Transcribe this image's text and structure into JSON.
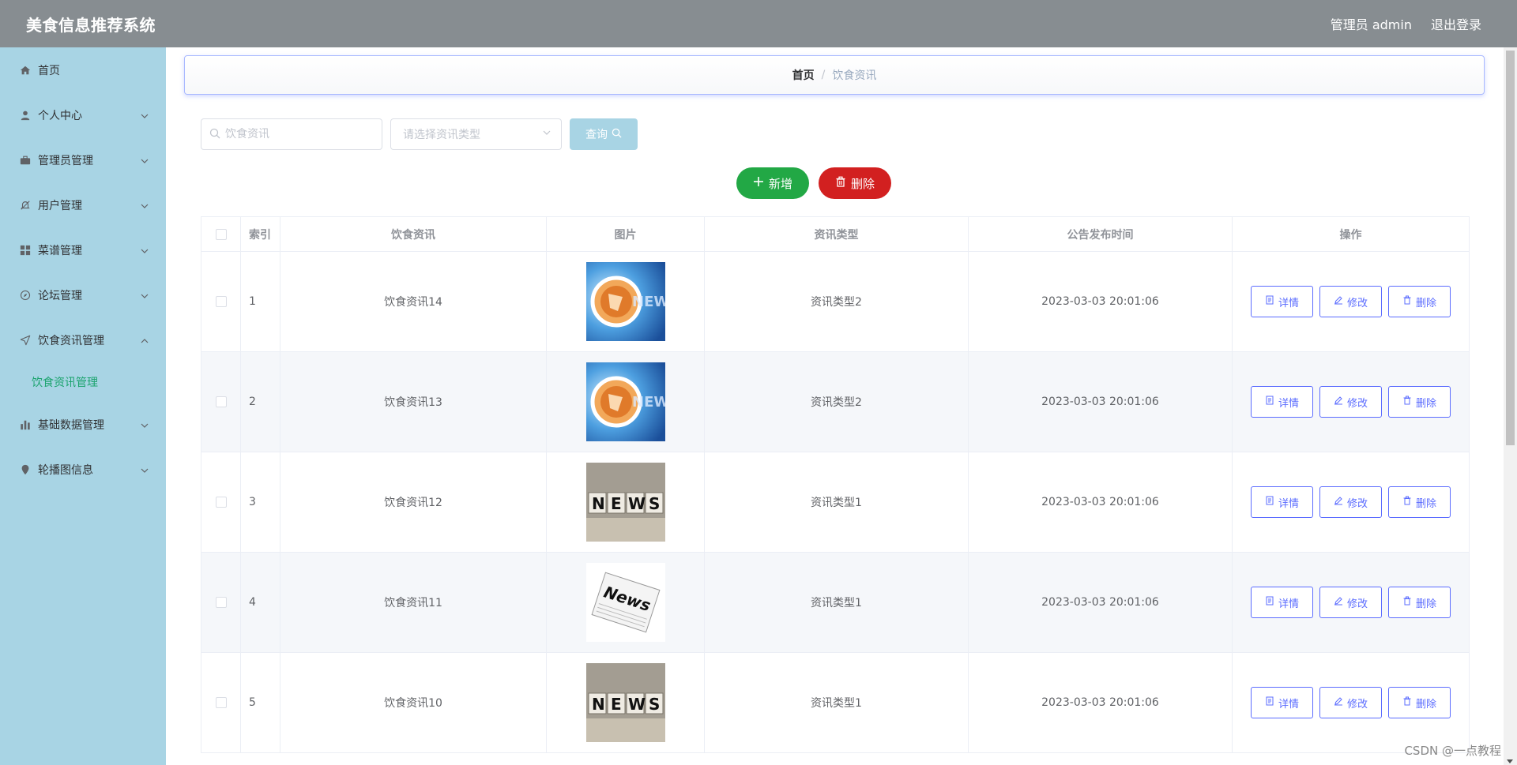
{
  "app": {
    "title": "美食信息推荐系统"
  },
  "header": {
    "user_label": "管理员 admin",
    "logout_label": "退出登录"
  },
  "sidebar": {
    "items": [
      {
        "label": "首页",
        "icon": "home-icon",
        "expandable": false
      },
      {
        "label": "个人中心",
        "icon": "user-icon",
        "expandable": true
      },
      {
        "label": "管理员管理",
        "icon": "briefcase-icon",
        "expandable": true
      },
      {
        "label": "用户管理",
        "icon": "bell-off-icon",
        "expandable": true
      },
      {
        "label": "菜谱管理",
        "icon": "grid-icon",
        "expandable": true
      },
      {
        "label": "论坛管理",
        "icon": "compass-icon",
        "expandable": true
      },
      {
        "label": "饮食资讯管理",
        "icon": "send-icon",
        "expandable": true,
        "expanded": true,
        "children": [
          "饮食资讯管理"
        ]
      },
      {
        "label": "基础数据管理",
        "icon": "bar-chart-icon",
        "expandable": true
      },
      {
        "label": "轮播图信息",
        "icon": "location-icon",
        "expandable": true
      }
    ],
    "active_sub": "饮食资讯管理"
  },
  "breadcrumb": {
    "home": "首页",
    "separator": "/",
    "current": "饮食资讯"
  },
  "search": {
    "keyword_placeholder": "饮食资讯",
    "type_placeholder": "请选择资讯类型",
    "query_label": "查询"
  },
  "actions": {
    "add_label": "新增",
    "delete_label": "删除"
  },
  "table": {
    "columns": [
      "索引",
      "饮食资讯",
      "图片",
      "资讯类型",
      "公告发布时间",
      "操作"
    ],
    "rows": [
      {
        "index": "1",
        "title": "饮食资讯14",
        "image": "globe-news",
        "type": "资讯类型2",
        "time": "2023-03-03 20:01:06"
      },
      {
        "index": "2",
        "title": "饮食资讯13",
        "image": "globe-news",
        "type": "资讯类型2",
        "time": "2023-03-03 20:01:06"
      },
      {
        "index": "3",
        "title": "饮食资讯12",
        "image": "cube-news",
        "type": "资讯类型1",
        "time": "2023-03-03 20:01:06"
      },
      {
        "index": "4",
        "title": "饮食资讯11",
        "image": "paper-news",
        "type": "资讯类型1",
        "time": "2023-03-03 20:01:06"
      },
      {
        "index": "5",
        "title": "饮食资讯10",
        "image": "cube-news",
        "type": "资讯类型1",
        "time": "2023-03-03 20:01:06"
      }
    ],
    "row_actions": {
      "detail": "详情",
      "edit": "修改",
      "delete": "删除"
    }
  },
  "watermark": "CSDN @一点教程",
  "colors": {
    "header_bg": "#878d91",
    "sidebar_bg": "#a8d4e4",
    "active_sub": "#1aa36d",
    "add_button": "#22a845",
    "delete_button": "#d22020",
    "outline_button": "#5b6cff"
  }
}
